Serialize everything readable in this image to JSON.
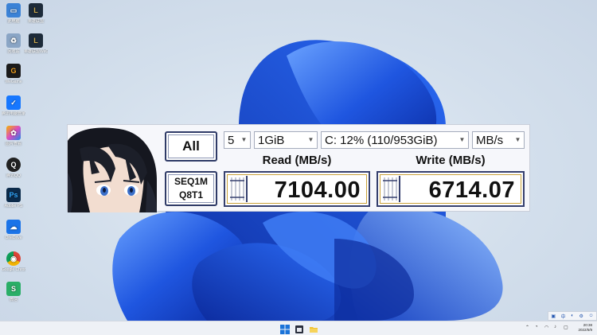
{
  "desktop": {
    "icons": [
      {
        "label": "此电脑",
        "glyph": "▭",
        "color": "#3b82d6"
      },
      {
        "label": "回收站",
        "glyph": "♻",
        "color": "#8aa5c5"
      },
      {
        "label": "WeGame",
        "glyph": "G",
        "color": "#1b1b1b"
      },
      {
        "label": "腾讯电脑管家",
        "glyph": "✓",
        "color": "#1677ff"
      },
      {
        "label": "图片查看",
        "glyph": "✿",
        "color": "#d94cc4"
      },
      {
        "label": "腾讯QQ",
        "glyph": "Q",
        "color": "#222"
      },
      {
        "label": "Adobe PS",
        "glyph": "Ps",
        "color": "#0b2a4a"
      },
      {
        "label": "OneDrive",
        "glyph": "☁",
        "color": "#1a73e8"
      },
      {
        "label": "Google Chrome",
        "glyph": "◉",
        "color": "#db4437"
      },
      {
        "label": "微信",
        "glyph": "S",
        "color": "#2aae67"
      }
    ],
    "icons_col2": [
      {
        "label": "英雄联盟",
        "glyph": "L",
        "color": "#1d2b3a"
      },
      {
        "label": "英雄联盟WeGame版",
        "glyph": "L",
        "color": "#1d2b3a"
      }
    ]
  },
  "cdm": {
    "all_button": "All",
    "test_line1": "SEQ1M",
    "test_line2": "Q8T1",
    "count": "5",
    "size": "1GiB",
    "drive": "C: 12% (110/953GiB)",
    "unit": "MB/s",
    "read_header": "Read (MB/s)",
    "write_header": "Write (MB/s)",
    "read_value": "7104.00",
    "write_value": "6714.07"
  },
  "taskbar": {
    "time": "20:38",
    "date": "2022/5/9",
    "ime": "中"
  }
}
